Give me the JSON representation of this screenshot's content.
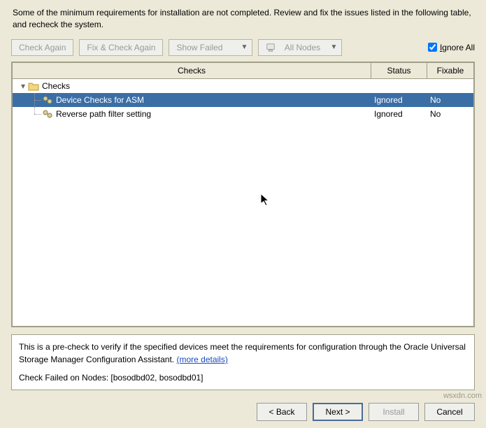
{
  "instruction_text": "Some of the minimum requirements for installation are not completed. Review and fix the issues listed in the following table, and recheck the system.",
  "toolbar": {
    "check_again": "Check Again",
    "fix_check_again": "Fix & Check Again",
    "show_failed": "Show Failed",
    "all_nodes": "All Nodes",
    "ignore_all": "Ignore All"
  },
  "table": {
    "headers": {
      "checks": "Checks",
      "status": "Status",
      "fixable": "Fixable"
    },
    "group_label": "Checks",
    "rows": [
      {
        "label": "Device Checks for ASM",
        "status": "Ignored",
        "fixable": "No",
        "selected": true
      },
      {
        "label": "Reverse path filter setting",
        "status": "Ignored",
        "fixable": "No",
        "selected": false
      }
    ]
  },
  "details": {
    "line1_prefix": "This is a pre-check to verify if the specified devices meet the requirements for configuration through the Oracle Universal Storage Manager Configuration Assistant. ",
    "more_details": "(more details)",
    "line2": "Check Failed on Nodes: [bosodbd02, bosodbd01]"
  },
  "nav": {
    "back": "< Back",
    "next": "Next >",
    "install": "Install",
    "cancel": "Cancel"
  },
  "watermark": "wsxdn.com"
}
